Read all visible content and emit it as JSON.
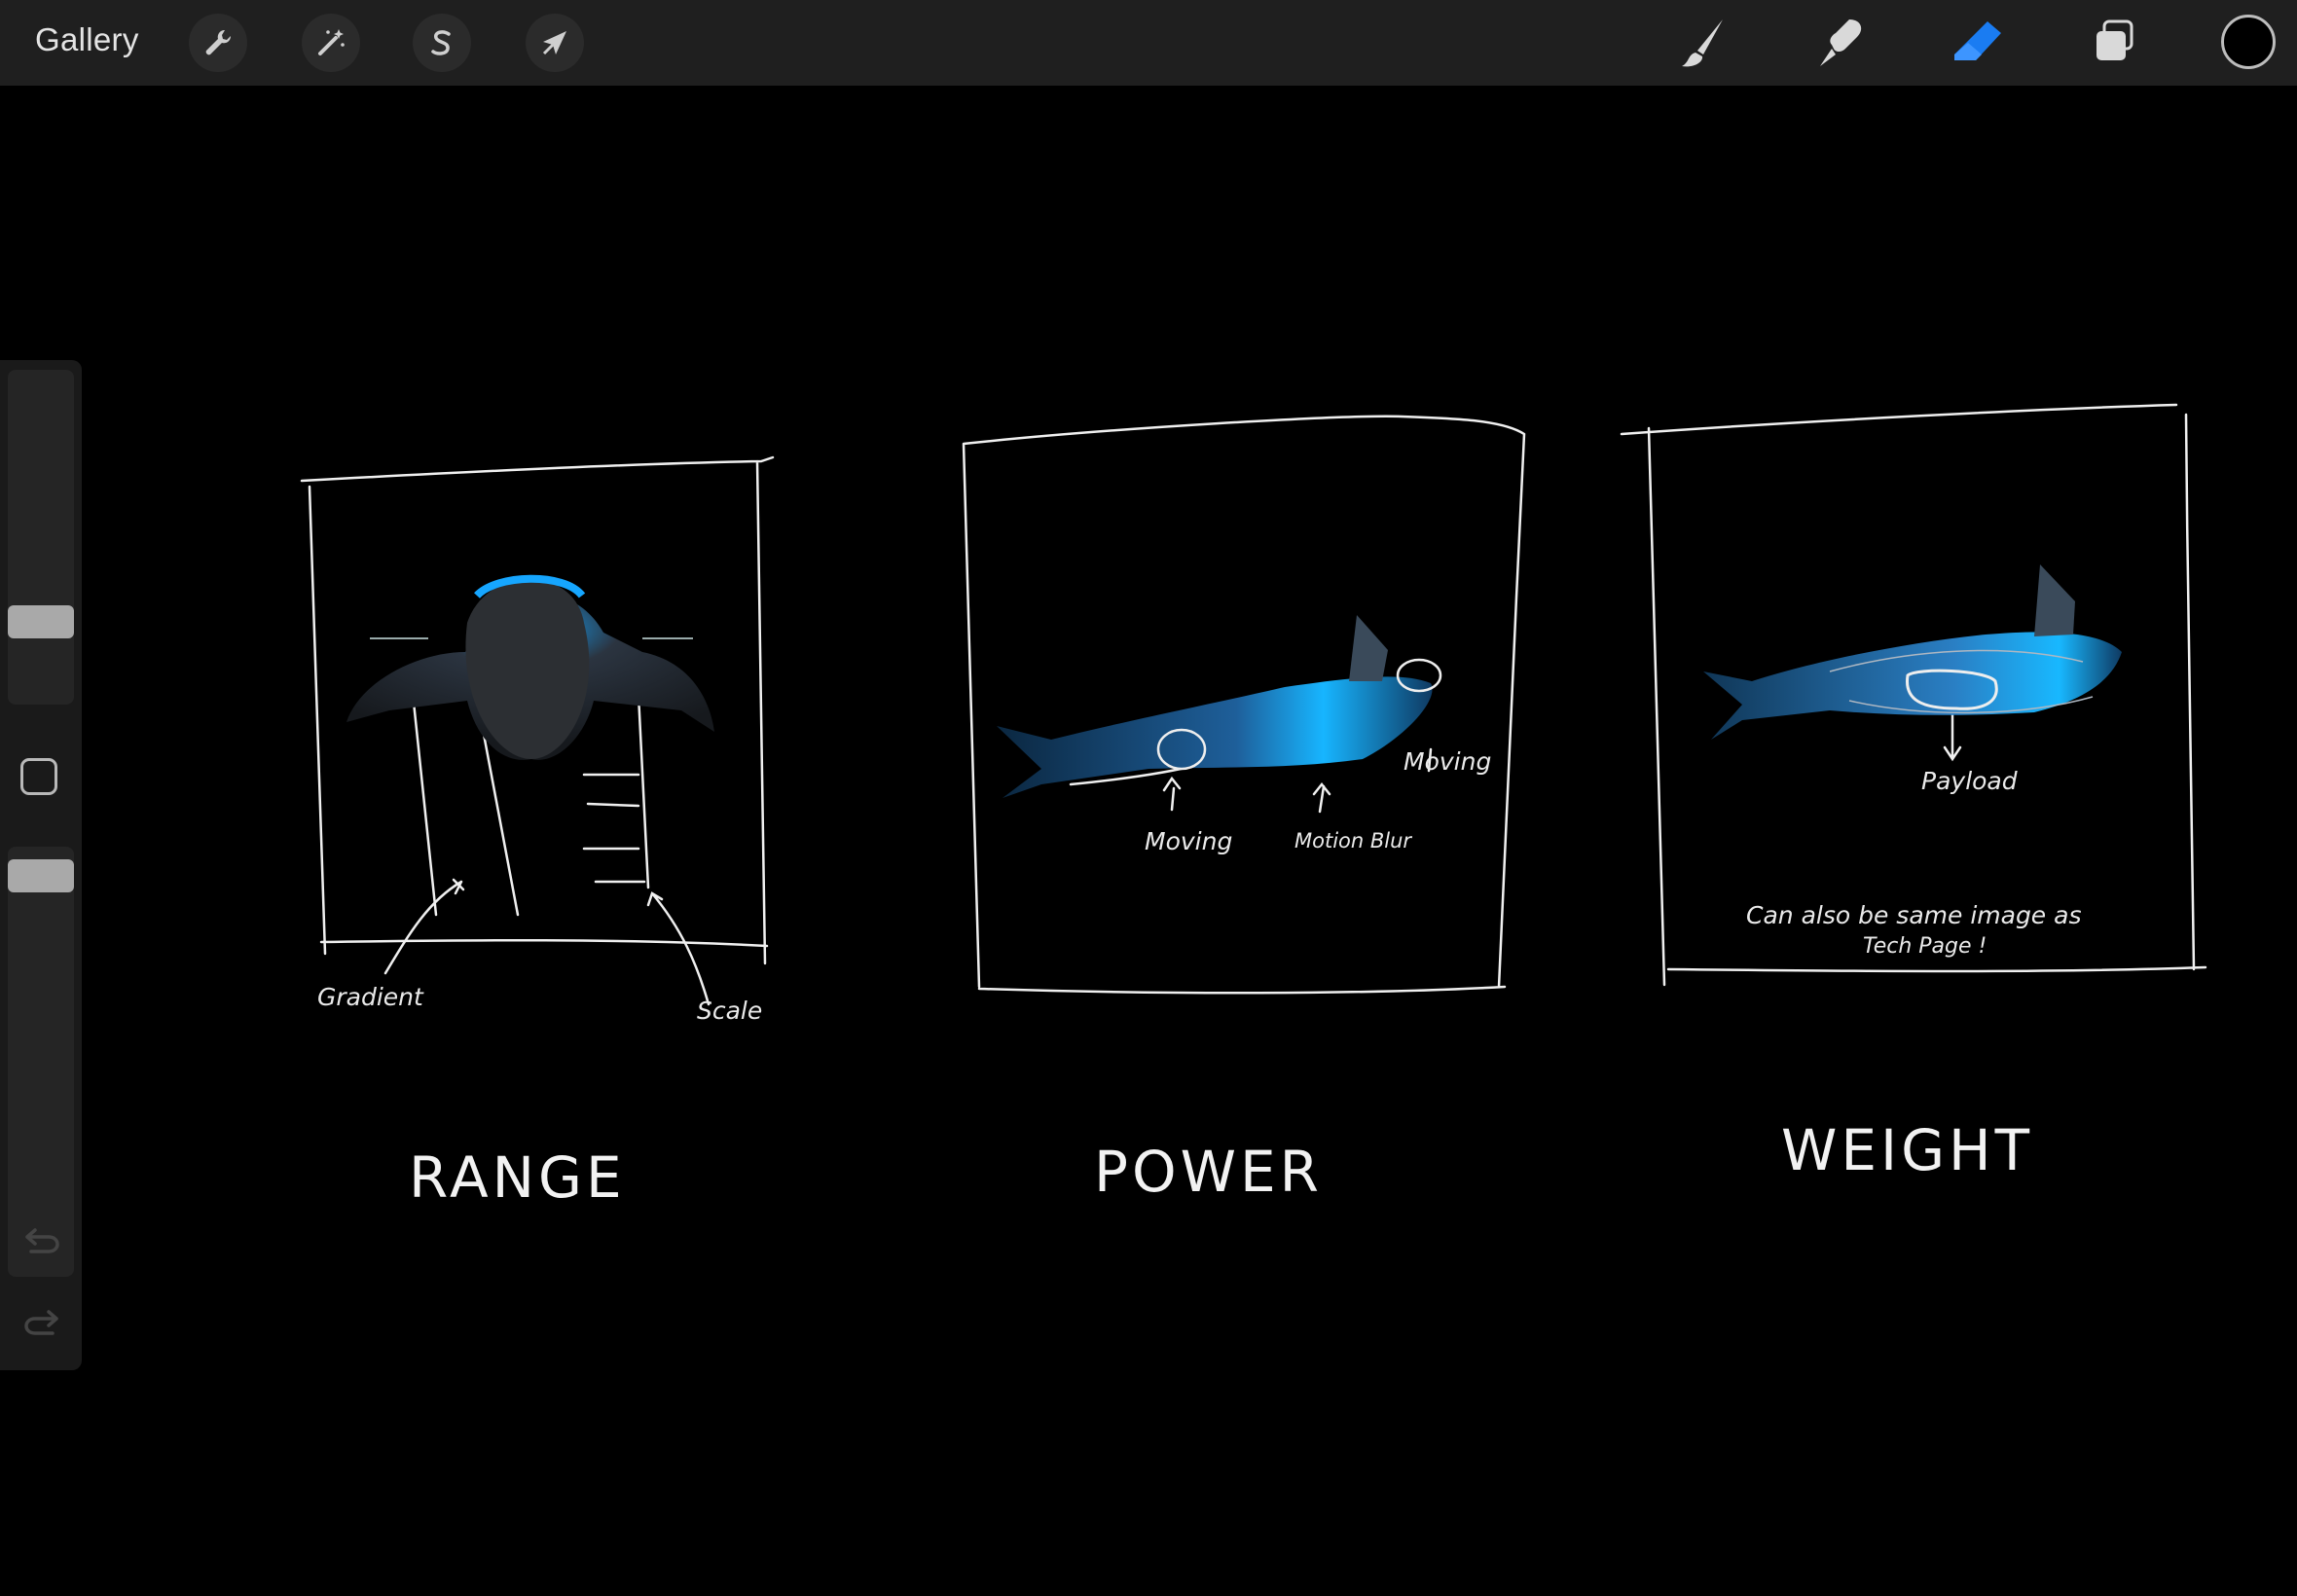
{
  "toolbar": {
    "gallery_label": "Gallery",
    "left_tools": [
      {
        "name": "actions",
        "icon": "wrench-icon"
      },
      {
        "name": "adjustments",
        "icon": "magic-wand-icon"
      },
      {
        "name": "selection",
        "icon": "selection-s-icon"
      },
      {
        "name": "transform",
        "icon": "arrow-cursor-icon"
      }
    ],
    "right_tools": [
      {
        "name": "brush",
        "icon": "brush-icon",
        "active": false
      },
      {
        "name": "smudge",
        "icon": "smudge-icon",
        "active": false
      },
      {
        "name": "eraser",
        "icon": "eraser-icon",
        "active": true
      },
      {
        "name": "layers",
        "icon": "layers-icon",
        "active": false
      }
    ],
    "current_color": "#000000",
    "accent_color": "#1a7cf2"
  },
  "sidebar": {
    "brush_size_level": 0.4,
    "opacity_level": 0.9,
    "modify_icon": "square-outline-icon",
    "undo_icon": "undo-icon",
    "redo_icon": "redo-icon"
  },
  "sketches": [
    {
      "title": "RANGE",
      "annotations": [
        "Gradient",
        "Scale"
      ]
    },
    {
      "title": "POWER",
      "annotations": [
        "Moving",
        "Motion Blur",
        "Moving"
      ]
    },
    {
      "title": "WEIGHT",
      "annotations": [
        "Payload",
        "Can also be same image as",
        "Tech Page !"
      ]
    }
  ]
}
